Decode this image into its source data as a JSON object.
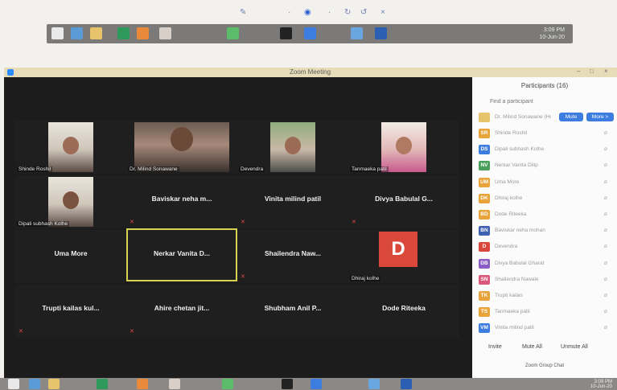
{
  "window": {
    "title": "Zoom Meeting",
    "controls": [
      "–",
      "□",
      "×"
    ]
  },
  "colors": {
    "accent": "#2d8cff",
    "active_border": "#d8d253",
    "avatar_d": "#d9483b",
    "mute_red": "#e04848"
  },
  "video_tiles": [
    {
      "kind": "camera",
      "style": "light",
      "label": "Shinde Roshil"
    },
    {
      "kind": "camera",
      "style": "wide",
      "label": "Dr. Milind Sonawane"
    },
    {
      "kind": "camera",
      "style": "green",
      "label": "Devendra"
    },
    {
      "kind": "camera",
      "style": "pink",
      "label": "Tanmaeka patil"
    },
    {
      "kind": "camera",
      "style": "light",
      "label": "Dipali subhash Kolhe"
    },
    {
      "kind": "name",
      "name": "Baviskar neha m..."
    },
    {
      "kind": "name",
      "name": "Vinita milind patil"
    },
    {
      "kind": "name",
      "name": "Divya Babulal G..."
    },
    {
      "kind": "name",
      "name": "Uma More"
    },
    {
      "kind": "name",
      "name": "Nerkar Vanita D...",
      "active": true
    },
    {
      "kind": "name",
      "name": "Shailendra Naw..."
    },
    {
      "kind": "avatar",
      "letter": "D",
      "label": "Dhiraj kolhe"
    },
    {
      "kind": "name",
      "name": "Trupti kailas kul..."
    },
    {
      "kind": "name",
      "name": "Ahire chetan jit..."
    },
    {
      "kind": "name",
      "name": "Shubham Anil P..."
    },
    {
      "kind": "name",
      "name": "Dode Riteeka"
    }
  ],
  "participants_panel": {
    "title": "Participants (16)",
    "find_placeholder": "Find a participant",
    "host_row": {
      "name": "Dr. Milind Sonawane (Host, me)",
      "mute_label": "Mute",
      "more_label": "More >"
    },
    "rows": [
      {
        "initials": "SR",
        "color": "#e8a33b",
        "name": "Shinde Roshil"
      },
      {
        "initials": "DS",
        "color": "#3d7de0",
        "name": "Dipali subhash Kolhe"
      },
      {
        "initials": "NV",
        "color": "#4aa05a",
        "name": "Nerkar Vanita Dilip"
      },
      {
        "initials": "UM",
        "color": "#e8a33b",
        "name": "Uma More"
      },
      {
        "initials": "DK",
        "color": "#e8a33b",
        "name": "Dhiraj kolhe"
      },
      {
        "initials": "BD",
        "color": "#e8a33b",
        "name": "Dode Riteeka"
      },
      {
        "initials": "BN",
        "color": "#3d5fb0",
        "name": "Baviskar neha mohan"
      },
      {
        "initials": "D",
        "color": "#d9483b",
        "name": "Devendra"
      },
      {
        "initials": "DB",
        "color": "#8a5cc6",
        "name": "Divya Babulal Gharat"
      },
      {
        "initials": "SN",
        "color": "#d95a7a",
        "name": "Shailendra Nawale"
      },
      {
        "initials": "TK",
        "color": "#e8a33b",
        "name": "Trupti kailas"
      },
      {
        "initials": "TS",
        "color": "#e8a33b",
        "name": "Tanmaeka patil"
      },
      {
        "initials": "VM",
        "color": "#3d7de0",
        "name": "Vinita milind patil"
      }
    ],
    "footer": {
      "invite": "Invite",
      "mute_all": "Mute All",
      "unmute_all": "Unmute All"
    },
    "chat_label": "Zoom Group Chat"
  },
  "top_clock": {
    "time": "3:09 PM",
    "date": "10-Jun-20"
  },
  "bottom_clock": {
    "time": "3:09 PM",
    "date": "10-Jun-20"
  },
  "taskbar_icons": [
    "windows-icon",
    "ie-icon",
    "folder-icon",
    "spreadsheet-icon",
    "firefox-icon",
    "paint-icon",
    "chrome-icon",
    "media-icon",
    "zoom-icon",
    "explorer-icon",
    "word-icon"
  ]
}
